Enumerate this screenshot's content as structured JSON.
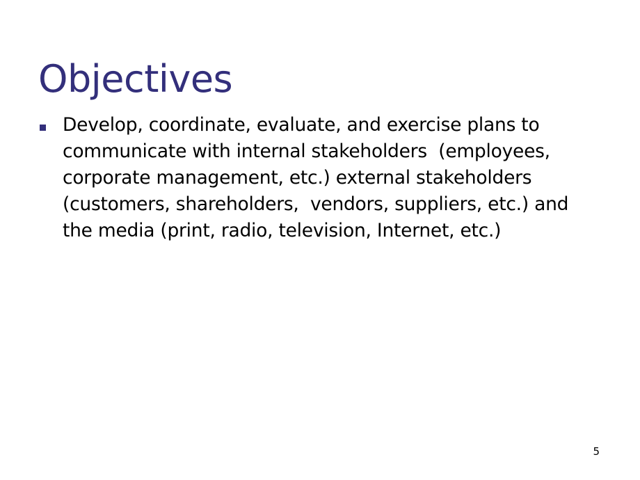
{
  "slide": {
    "title": "Objectives",
    "background_color": "#ffffff",
    "accent_color": "#332f7b",
    "body_text_color": "#000000",
    "page_number": "5",
    "bullets": [
      {
        "marker": "square-bullet",
        "text": "Develop, coordinate, evaluate, and exercise plans to communicate with internal stakeholders  (employees, corporate management, etc.) external stakeholders (customers, shareholders,  vendors, suppliers, etc.) and the media (print, radio, television, Internet, etc.)"
      }
    ]
  }
}
